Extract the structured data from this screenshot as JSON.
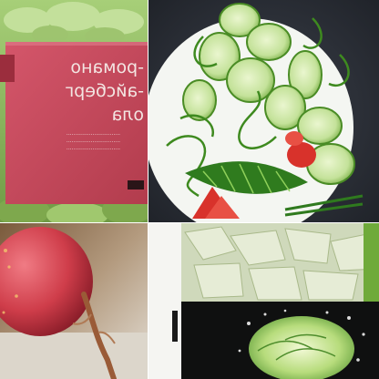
{
  "collage": {
    "tiles": [
      {
        "subject": "salad package",
        "label_lines": [
          "-романо",
          "-айсберг",
          "ола"
        ],
        "package_fine_print": [
          "·······························",
          "·······························",
          "·······························"
        ]
      },
      {
        "subject": "sliced cucumber with tomato"
      },
      {
        "subject": "red radish"
      },
      {
        "subject": "chopped lettuce and lettuce in water"
      }
    ]
  },
  "colors": {
    "package_red": "#c9485a",
    "lettuce_green": "#8ab85a",
    "cucumber_green": "#bfdc9a",
    "tomato_red": "#d8322b",
    "radish_red": "#c93d4a"
  }
}
